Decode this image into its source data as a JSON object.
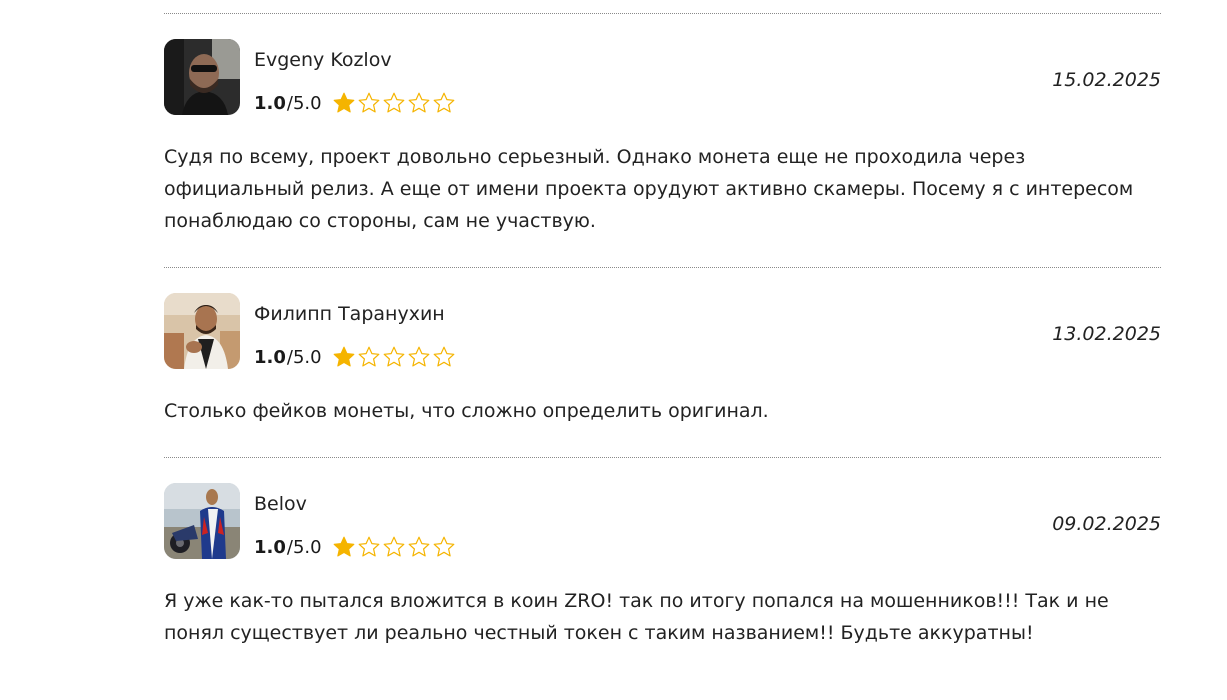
{
  "colors": {
    "star_fill": "#f5b400",
    "star_outline": "#f5b400",
    "divider": "#8a8a8a",
    "text": "#222222"
  },
  "reviews": [
    {
      "author": "Evgeny Kozlov",
      "score": "1.0",
      "max": "5.0",
      "filled_stars": 1,
      "total_stars": 5,
      "date": "15.02.2025",
      "text": "Судя по всему, проект довольно серьезный. Однако монета еще не проходила через официальный релиз. А еще от имени проекта орудуют активно скамеры. Посему я с интересом понаблюдаю со стороны, сам не участвую."
    },
    {
      "author": "Филипп Таранухин",
      "score": "1.0",
      "max": "5.0",
      "filled_stars": 1,
      "total_stars": 5,
      "date": "13.02.2025",
      "text": "Столько фейков монеты, что сложно определить оригинал."
    },
    {
      "author": "Belov",
      "score": "1.0",
      "max": "5.0",
      "filled_stars": 1,
      "total_stars": 5,
      "date": "09.02.2025",
      "text": "Я уже как-то пытался вложится в коин ZRO! так по итогу попался на мошенников!!! Так и не понял существует ли реально честный токен с таким названием!! Будьте аккуратны!"
    }
  ]
}
